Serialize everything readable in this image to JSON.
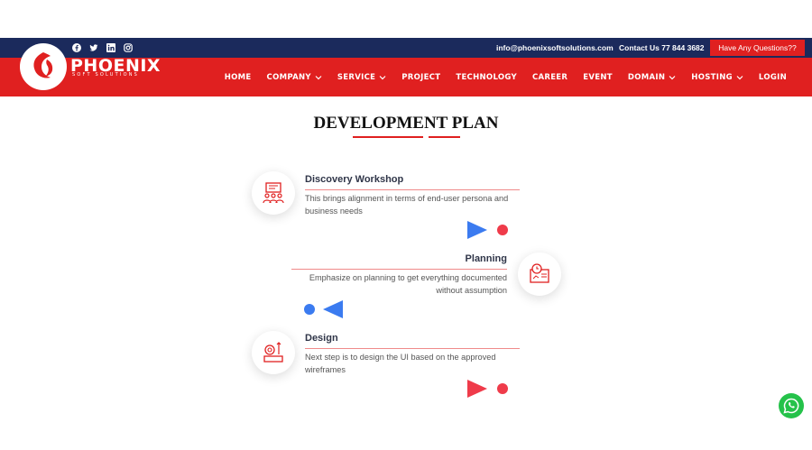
{
  "brand": {
    "name": "PHOENIX",
    "tagline": "SOFT SOLUTIONS"
  },
  "social_icons": [
    "facebook-icon",
    "twitter-icon",
    "linkedin-icon",
    "instagram-icon"
  ],
  "contact": {
    "email": "info@phoenixsoftsolutions.com",
    "phone": "Contact Us 77 844 3682"
  },
  "ask_button": "Have Any Questions??",
  "menu": [
    {
      "label": "HOME",
      "dropdown": false
    },
    {
      "label": "COMPANY",
      "dropdown": true
    },
    {
      "label": "SERVICE",
      "dropdown": true
    },
    {
      "label": "PROJECT",
      "dropdown": false
    },
    {
      "label": "TECHNOLOGY",
      "dropdown": false
    },
    {
      "label": "CAREER",
      "dropdown": false
    },
    {
      "label": "EVENT",
      "dropdown": false
    },
    {
      "label": "DOMAIN",
      "dropdown": true
    },
    {
      "label": "HOSTING",
      "dropdown": true
    },
    {
      "label": "LOGIN",
      "dropdown": false
    }
  ],
  "section": {
    "title": "DEVELOPMENT PLAN"
  },
  "steps": [
    {
      "title": "Discovery Workshop",
      "desc_line1": "This brings alignment in terms of end-user persona and",
      "desc_line2": "business needs",
      "icon": "workshop-icon"
    },
    {
      "title": "Planning",
      "desc_line1": "Emphasize on planning to get everything documented",
      "desc_line2": "without assumption",
      "icon": "planning-icon"
    },
    {
      "title": "Design",
      "desc_line1": "Next step is to design the UI based on the approved",
      "desc_line2": "wireframes",
      "icon": "design-icon"
    }
  ],
  "colors": {
    "topbar": "#1b2a5c",
    "brand_red": "#e02020",
    "flow_blue": "#3b7bf0",
    "flow_purple": "#a25cf0",
    "whatsapp": "#25c24a"
  }
}
